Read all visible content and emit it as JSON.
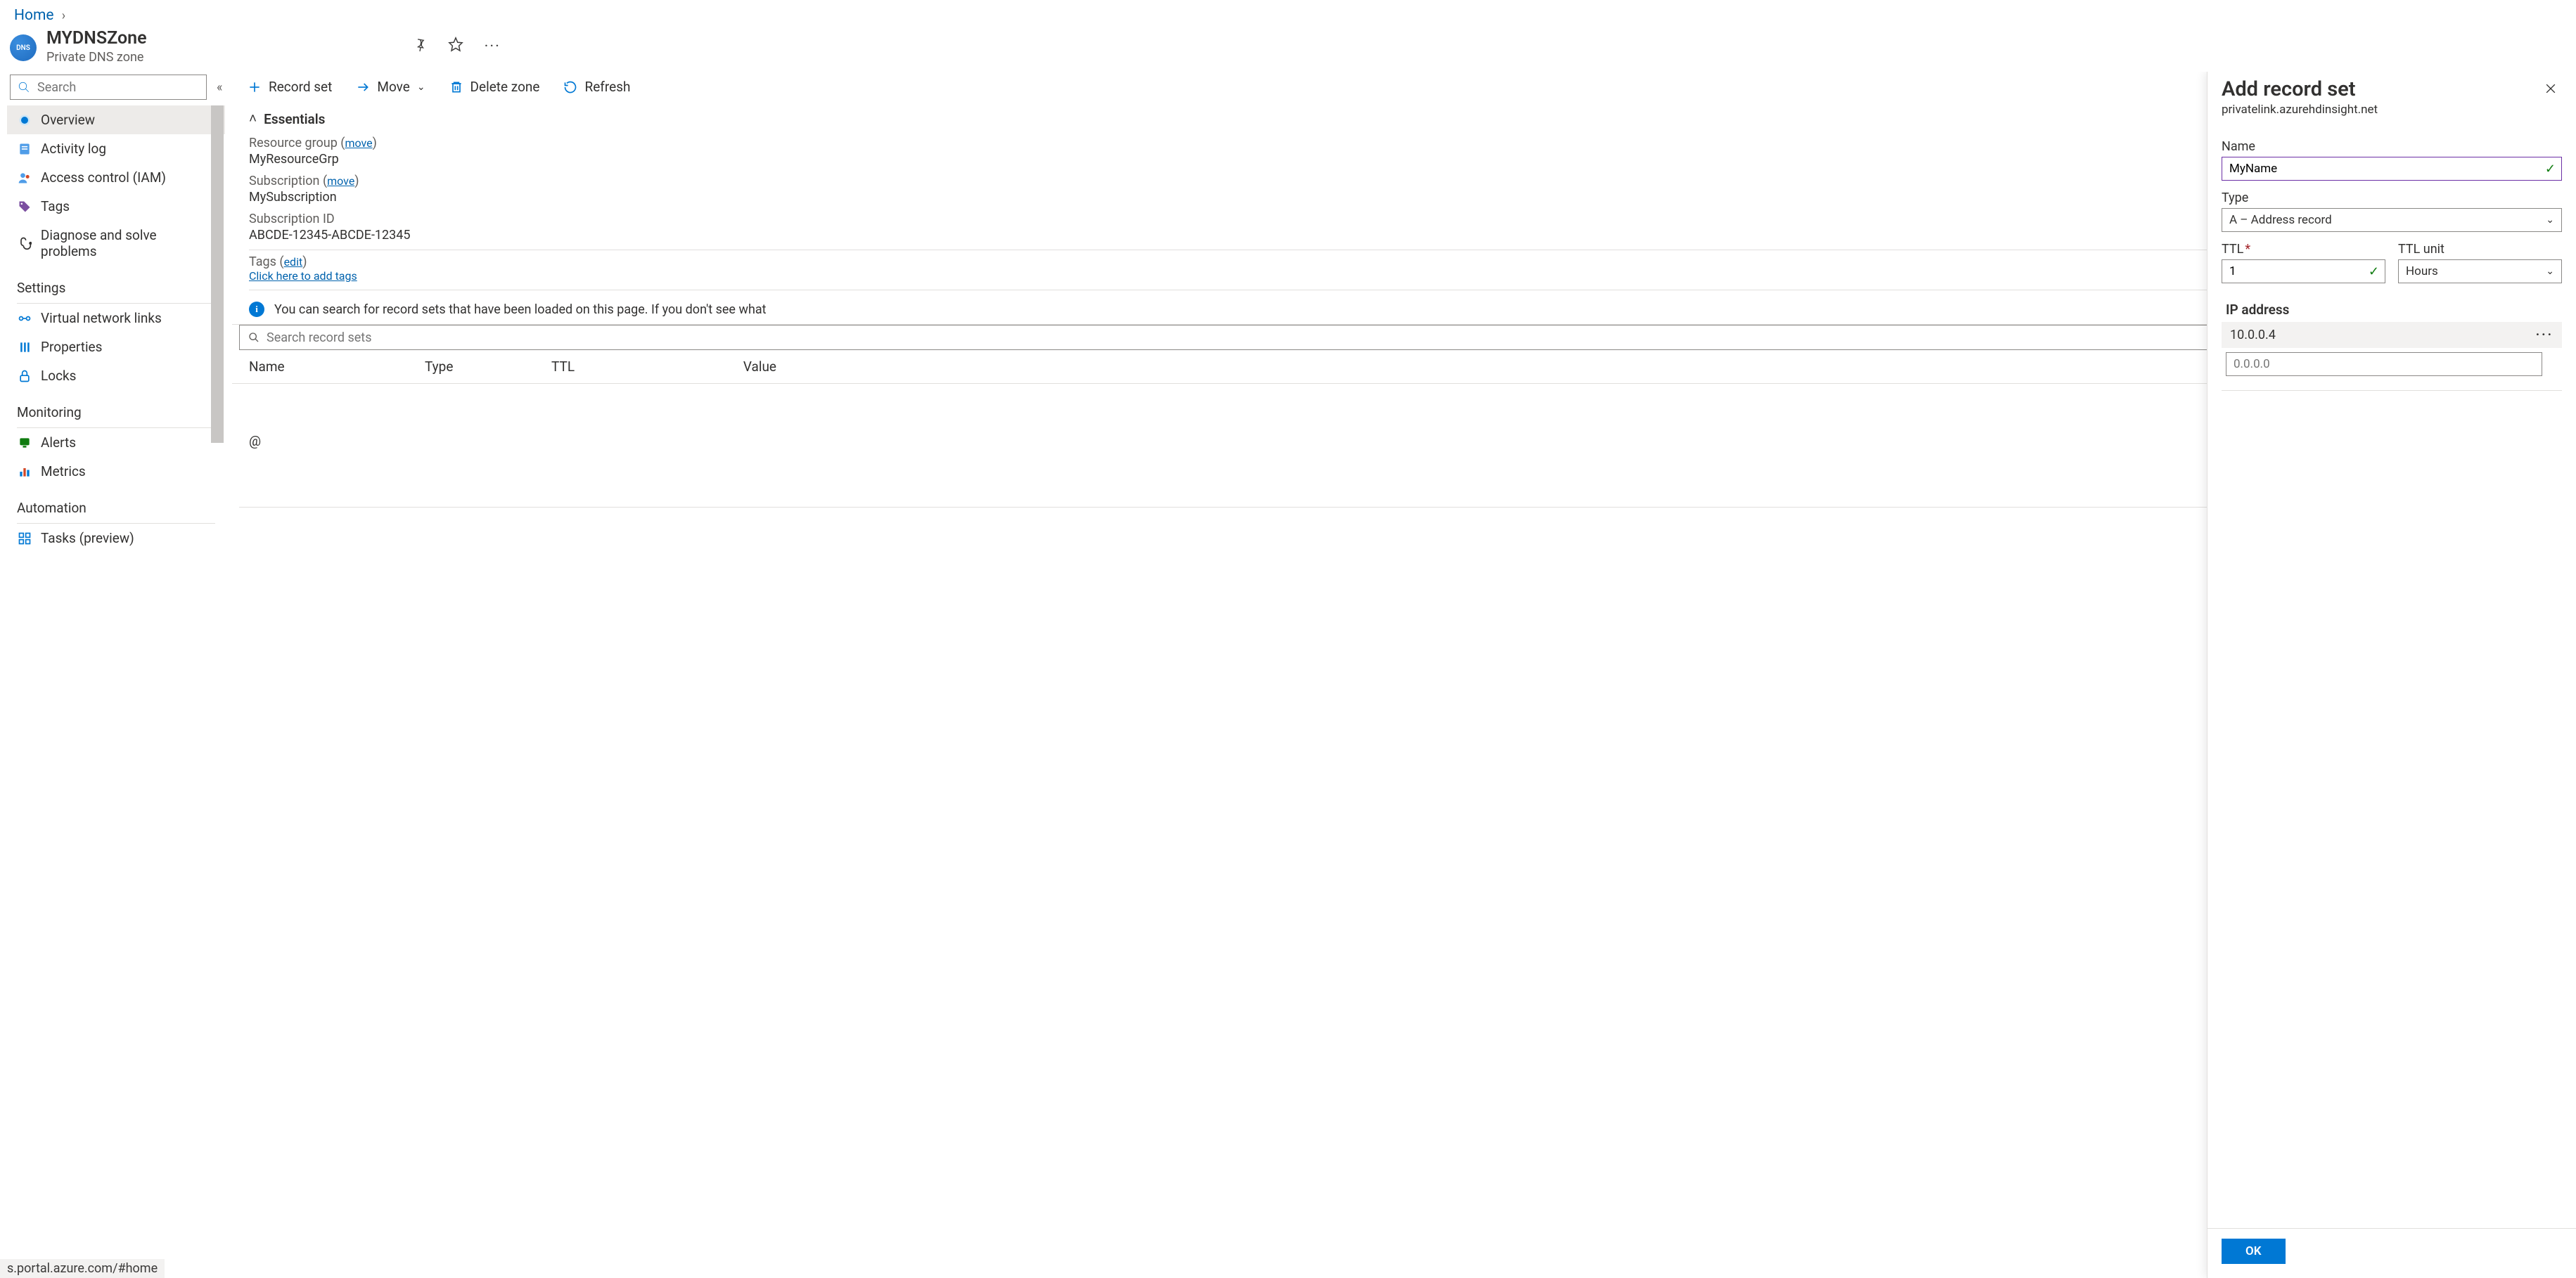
{
  "breadcrumb": {
    "home": "Home"
  },
  "resource": {
    "icon_text": "DNS",
    "title": "MYDNSZone",
    "subtitle": "Private DNS zone"
  },
  "header_actions": {
    "pin_title": "Pin",
    "favorite_title": "Favorite",
    "more_title": "More"
  },
  "left": {
    "search_placeholder": "Search",
    "items": {
      "overview": "Overview",
      "activity_log": "Activity log",
      "access_control": "Access control (IAM)",
      "tags": "Tags",
      "diagnose": "Diagnose and solve problems"
    },
    "groups": {
      "settings": "Settings",
      "monitoring": "Monitoring",
      "automation": "Automation"
    },
    "settings_items": {
      "vnet_links": "Virtual network links",
      "properties": "Properties",
      "locks": "Locks"
    },
    "monitoring_items": {
      "alerts": "Alerts",
      "metrics": "Metrics"
    },
    "automation_items": {
      "tasks": "Tasks (preview)"
    }
  },
  "toolbar": {
    "record_set": "Record set",
    "move": "Move",
    "delete_zone": "Delete zone",
    "refresh": "Refresh"
  },
  "essentials": {
    "toggle_label": "Essentials",
    "resource_group_label": "Resource group (",
    "resource_group_move": "move",
    "resource_group_label_close": ")",
    "resource_group_value": "MyResourceGrp",
    "subscription_label": "Subscription (",
    "subscription_move": "move",
    "subscription_label_close": ")",
    "subscription_value": "MySubscription",
    "subscription_id_label": "Subscription ID",
    "subscription_id_value": "ABCDE-12345-ABCDE-12345",
    "tags_label": "Tags (",
    "tags_edit": "edit",
    "tags_label_close": ")",
    "tags_link": "Click here to add tags"
  },
  "info_banner": "You can search for record sets that have been loaded on this page. If you don't see what",
  "records": {
    "search_placeholder": "Search record sets",
    "headers": {
      "name": "Name",
      "type": "Type",
      "ttl": "TTL",
      "value": "Value"
    },
    "rows": [
      {
        "name": "@"
      }
    ]
  },
  "panel": {
    "title": "Add record set",
    "subtitle": "privatelink.azurehdinsight.net",
    "name_label": "Name",
    "name_value": "MyName",
    "type_label": "Type",
    "type_value": "A – Address record",
    "ttl_label": "TTL",
    "ttl_value": "1",
    "ttl_unit_label": "TTL unit",
    "ttl_unit_value": "Hours",
    "ip_section": "IP address",
    "ip_rows": [
      "10.0.0.4"
    ],
    "ip_placeholder": "0.0.0.0",
    "ok": "OK"
  },
  "status_url": "s.portal.azure.com/#home"
}
